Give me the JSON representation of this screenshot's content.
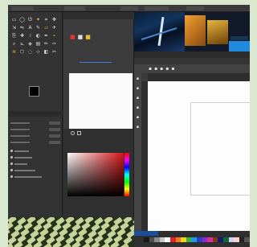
{
  "window": {
    "title_segments": [
      "",
      "",
      "",
      "",
      ""
    ]
  },
  "toolbox": {
    "tools": [
      {
        "icon": "rect-select-icon",
        "glyph": "▭"
      },
      {
        "icon": "ellipse-select-icon",
        "glyph": "◯"
      },
      {
        "icon": "lasso-icon",
        "glyph": "ᘎ"
      },
      {
        "icon": "magic-wand-icon",
        "glyph": "✦"
      },
      {
        "icon": "crop-icon",
        "glyph": "⌗"
      },
      {
        "icon": "move-icon",
        "glyph": "✥"
      },
      {
        "icon": "transform-icon",
        "glyph": "⇲"
      },
      {
        "icon": "flip-icon",
        "glyph": "⇋"
      },
      {
        "icon": "text-icon",
        "glyph": "A"
      },
      {
        "icon": "brush-icon",
        "glyph": "✎"
      },
      {
        "icon": "eraser-icon",
        "glyph": "▱"
      },
      {
        "icon": "airbrush-icon",
        "glyph": "✈"
      },
      {
        "icon": "clone-icon",
        "glyph": "⎘"
      },
      {
        "icon": "heal-icon",
        "glyph": "✚"
      },
      {
        "icon": "smudge-icon",
        "glyph": "☝"
      },
      {
        "icon": "dodge-icon",
        "glyph": "◐"
      },
      {
        "icon": "path-icon",
        "glyph": "✒"
      },
      {
        "icon": "color-picker-icon",
        "glyph": "⌁"
      },
      {
        "icon": "zoom-icon",
        "glyph": "⌕"
      },
      {
        "icon": "measure-icon",
        "glyph": "⊾"
      },
      {
        "icon": "bucket-fill-icon",
        "glyph": "◈"
      },
      {
        "icon": "gradient-icon",
        "glyph": "▤"
      },
      {
        "icon": "pencil-icon",
        "glyph": "✏"
      },
      {
        "icon": "ink-icon",
        "glyph": "✑"
      },
      {
        "icon": "warp-icon",
        "glyph": "≋"
      },
      {
        "icon": "cage-icon",
        "glyph": "⬡"
      },
      {
        "icon": "blur-icon",
        "glyph": "◌"
      },
      {
        "icon": "handle-icon",
        "glyph": "⊹"
      },
      {
        "icon": "foreground-select-icon",
        "glyph": "◧"
      },
      {
        "icon": "scissors-icon",
        "glyph": "✂"
      }
    ],
    "highlight_colors": [
      "#f0c040"
    ],
    "options_tabs": [
      "",
      ""
    ],
    "option_rows": 4,
    "checkbox_rows": 5
  },
  "colors": {
    "foreground": "#000000",
    "background": "#ffffff",
    "accent_blue": "#3d7fd6"
  },
  "palette": [
    "#1a1a1a",
    "#4d4d4d",
    "#8c8c8c",
    "#c8c8c8",
    "#ffffff",
    "#e52222",
    "#f07a1a",
    "#f2d21c",
    "#3cb43c",
    "#1e9be0",
    "#2a3fd0",
    "#8a2ad0",
    "#e02a9a",
    "#7a3a12",
    "#1a1a6a",
    "#0d6a3a",
    "#d0d0ff",
    "#ffd0d0",
    "#222222",
    "#555555"
  ]
}
